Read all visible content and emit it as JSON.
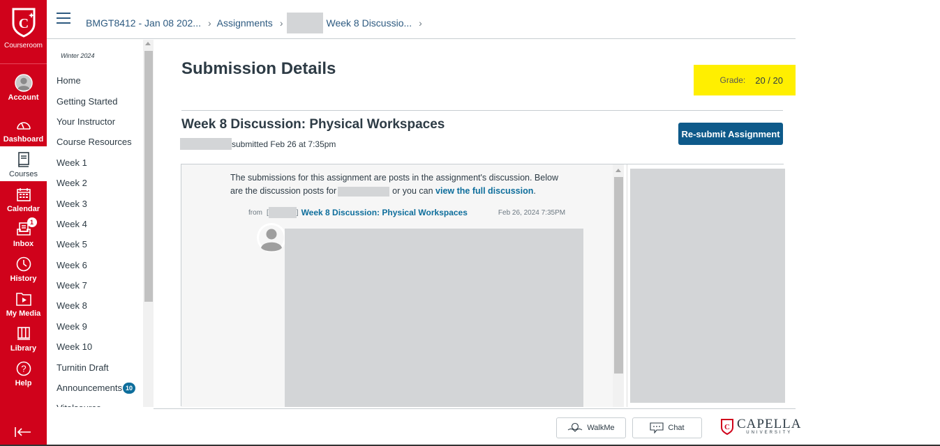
{
  "global_nav": {
    "logo_label": "Courseroom",
    "items": [
      {
        "label": "Account",
        "icon": "account-avatar-icon"
      },
      {
        "label": "Dashboard",
        "icon": "speedometer-icon"
      },
      {
        "label": "Courses",
        "icon": "book-icon",
        "active": true
      },
      {
        "label": "Calendar",
        "icon": "calendar-icon"
      },
      {
        "label": "Inbox",
        "icon": "inbox-icon",
        "badge": "1"
      },
      {
        "label": "History",
        "icon": "clock-icon"
      },
      {
        "label": "My Media",
        "icon": "media-folder-icon"
      },
      {
        "label": "Library",
        "icon": "library-icon"
      },
      {
        "label": "Help",
        "icon": "help-icon"
      }
    ],
    "collapse_icon": "collapse-arrow-icon"
  },
  "header": {
    "breadcrumbs": [
      {
        "label": "BMGT8412 - Jan 08 202..."
      },
      {
        "label": "Assignments"
      },
      {
        "label": "",
        "redacted": true
      },
      {
        "label": "Week 8 Discussio..."
      }
    ]
  },
  "course_nav": {
    "term": "Winter 2024",
    "items": [
      {
        "label": "Home"
      },
      {
        "label": "Getting Started"
      },
      {
        "label": "Your Instructor"
      },
      {
        "label": "Course Resources"
      },
      {
        "label": "Week 1"
      },
      {
        "label": "Week 2"
      },
      {
        "label": "Week 3"
      },
      {
        "label": "Week 4"
      },
      {
        "label": "Week 5"
      },
      {
        "label": "Week 6"
      },
      {
        "label": "Week 7"
      },
      {
        "label": "Week 8"
      },
      {
        "label": "Week 9"
      },
      {
        "label": "Week 10"
      },
      {
        "label": "Turnitin Draft"
      },
      {
        "label": "Announcements",
        "badge": "10"
      },
      {
        "label": "Vitalsource"
      }
    ]
  },
  "main": {
    "title": "Submission Details",
    "grade_label": "Grade:",
    "grade_value": "20 / 20",
    "grade_highlight_color": "#ffef00",
    "assignment_title": "Week 8 Discussion: Physical Workspaces",
    "submitted_text": "submitted Feb 26 at 7:35pm",
    "resubmit_label": "Re-submit Assignment",
    "discussion": {
      "intro_part1": "The submissions for this assignment are posts in the assignment's discussion. Below are the discussion posts for",
      "intro_part2": "or you can",
      "intro_link": "view the full discussion",
      "intro_end": ".",
      "from_label": "from",
      "post_link": "Week 8 Discussion: Physical Workspaces",
      "post_date": "Feb 26, 2024 7:35PM"
    }
  },
  "footer": {
    "walkme_label": "WalkMe",
    "chat_label": "Chat",
    "brand_name": "CAPELLA",
    "brand_sub": "UNIVERSITY"
  },
  "colors": {
    "brand_red": "#d0021b",
    "link_blue": "#0e6e9c",
    "button_blue": "#0e5a8a"
  }
}
